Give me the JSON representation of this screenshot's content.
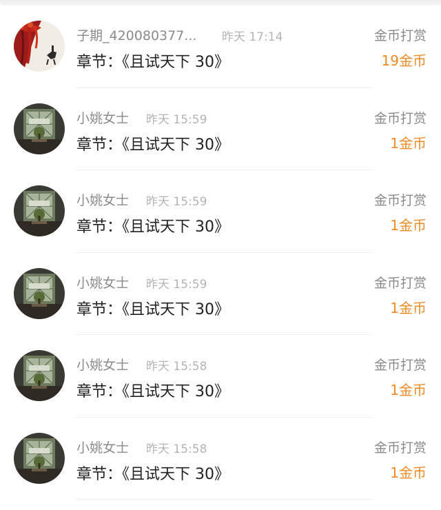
{
  "accent_color": "#f08a24",
  "rows": [
    {
      "avatar": "red-ink-painting-avatar",
      "name": "子期_420080377...",
      "time": "昨天 17:14",
      "chapter_label": "章节：",
      "chapter_title": "《且试天下 30》",
      "type": "金币打赏",
      "amount": "19金币"
    },
    {
      "avatar": "window-tree-avatar",
      "name": "小姚女士",
      "time": "昨天 15:59",
      "chapter_label": "章节：",
      "chapter_title": "《且试天下 30》",
      "type": "金币打赏",
      "amount": "1金币"
    },
    {
      "avatar": "window-tree-avatar",
      "name": "小姚女士",
      "time": "昨天 15:59",
      "chapter_label": "章节：",
      "chapter_title": "《且试天下 30》",
      "type": "金币打赏",
      "amount": "1金币"
    },
    {
      "avatar": "window-tree-avatar",
      "name": "小姚女士",
      "time": "昨天 15:59",
      "chapter_label": "章节：",
      "chapter_title": "《且试天下 30》",
      "type": "金币打赏",
      "amount": "1金币"
    },
    {
      "avatar": "window-tree-avatar",
      "name": "小姚女士",
      "time": "昨天 15:58",
      "chapter_label": "章节：",
      "chapter_title": "《且试天下 30》",
      "type": "金币打赏",
      "amount": "1金币"
    },
    {
      "avatar": "window-tree-avatar",
      "name": "小姚女士",
      "time": "昨天 15:58",
      "chapter_label": "章节：",
      "chapter_title": "《且试天下 30》",
      "type": "金币打赏",
      "amount": "1金币"
    }
  ]
}
